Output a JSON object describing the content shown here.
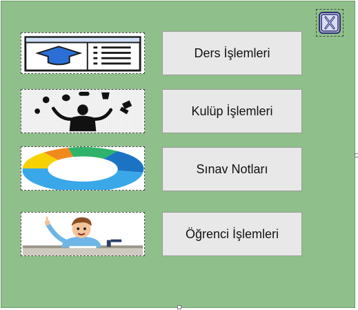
{
  "buttons": {
    "ders": "Ders İşlemleri",
    "kulup": "Kulüp İşlemleri",
    "sinav": "Sınav Notları",
    "ogrenci": "Öğrenci İşlemleri"
  },
  "icons": {
    "close": "excel-close-icon",
    "ders_pic": "browser-graduation-cap-icon",
    "kulup_pic": "juggling-person-icon",
    "sinav_pic": "donut-chart-icon",
    "ogrenci_pic": "student-at-desk-icon"
  },
  "colors": {
    "form_background": "#8fbf8a",
    "button_background": "#e8e8e8",
    "donut": [
      "#f7d100",
      "#f08a1e",
      "#2fb36b",
      "#1c73c4",
      "#3aa8e8"
    ]
  }
}
